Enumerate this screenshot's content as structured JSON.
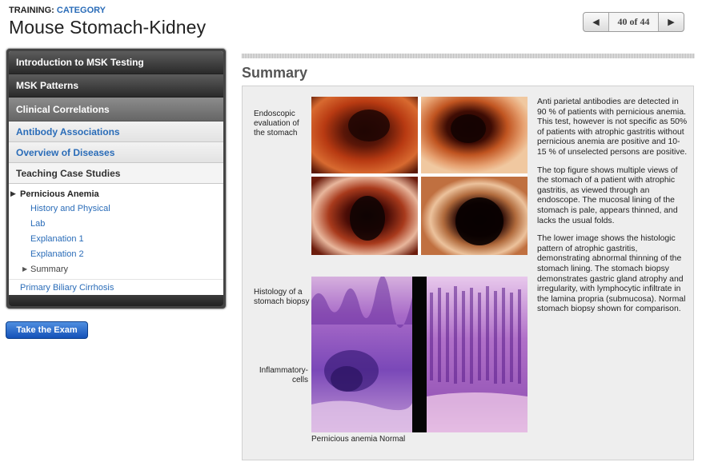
{
  "header": {
    "breadcrumb_prefix": "TRAINING:",
    "breadcrumb_category": "CATEGORY",
    "title": "Mouse Stomach-Kidney"
  },
  "pager": {
    "prev_icon": "triangle-left-icon",
    "next_icon": "triangle-right-icon",
    "count_label": "40 of 44"
  },
  "sidebar": {
    "sections": [
      "Introduction to MSK Testing",
      "MSK Patterns",
      "Clinical Correlations",
      "Antibody Associations",
      "Overview of Diseases",
      "Teaching Case Studies"
    ],
    "case": {
      "title": "Pernicious Anemia",
      "items": [
        "History and Physical",
        "Lab",
        "Explanation 1",
        "Explanation 2"
      ],
      "current": "Summary"
    },
    "other_case": "Primary Biliary Cirrhosis"
  },
  "actions": {
    "exam_label": "Take the Exam"
  },
  "main": {
    "section_title": "Summary",
    "captions": {
      "endoscopic": "Endoscopic evaluation of the stomach",
      "histology": "Histology of a stomach biopsy",
      "inflammatory": "Inflammatory-cells",
      "bottom": "Pernicious anemia Normal"
    },
    "paragraphs": [
      "Anti parietal antibodies are detected in 90 % of patients with pernicious anemia. This test, however is not specific as 50% of patients with atrophic gastritis without pernicious anemia are positive and 10-15 % of unselected persons are positive.",
      "The top figure shows multiple views of the stomach of a patient with atrophic gastritis, as viewed through an endoscope. The mucosal lining of the stomach is pale, appears thinned, and lacks the usual folds.",
      "The lower image shows the histologic pattern of atrophic gastritis, demonstrating abnormal thinning of the stomach lining. The stomach biopsy demonstrates gastric gland atrophy and irregularity, with lymphocytic infiltrate in the lamina propria (submucosa). Normal stomach biopsy shown for comparison."
    ]
  }
}
